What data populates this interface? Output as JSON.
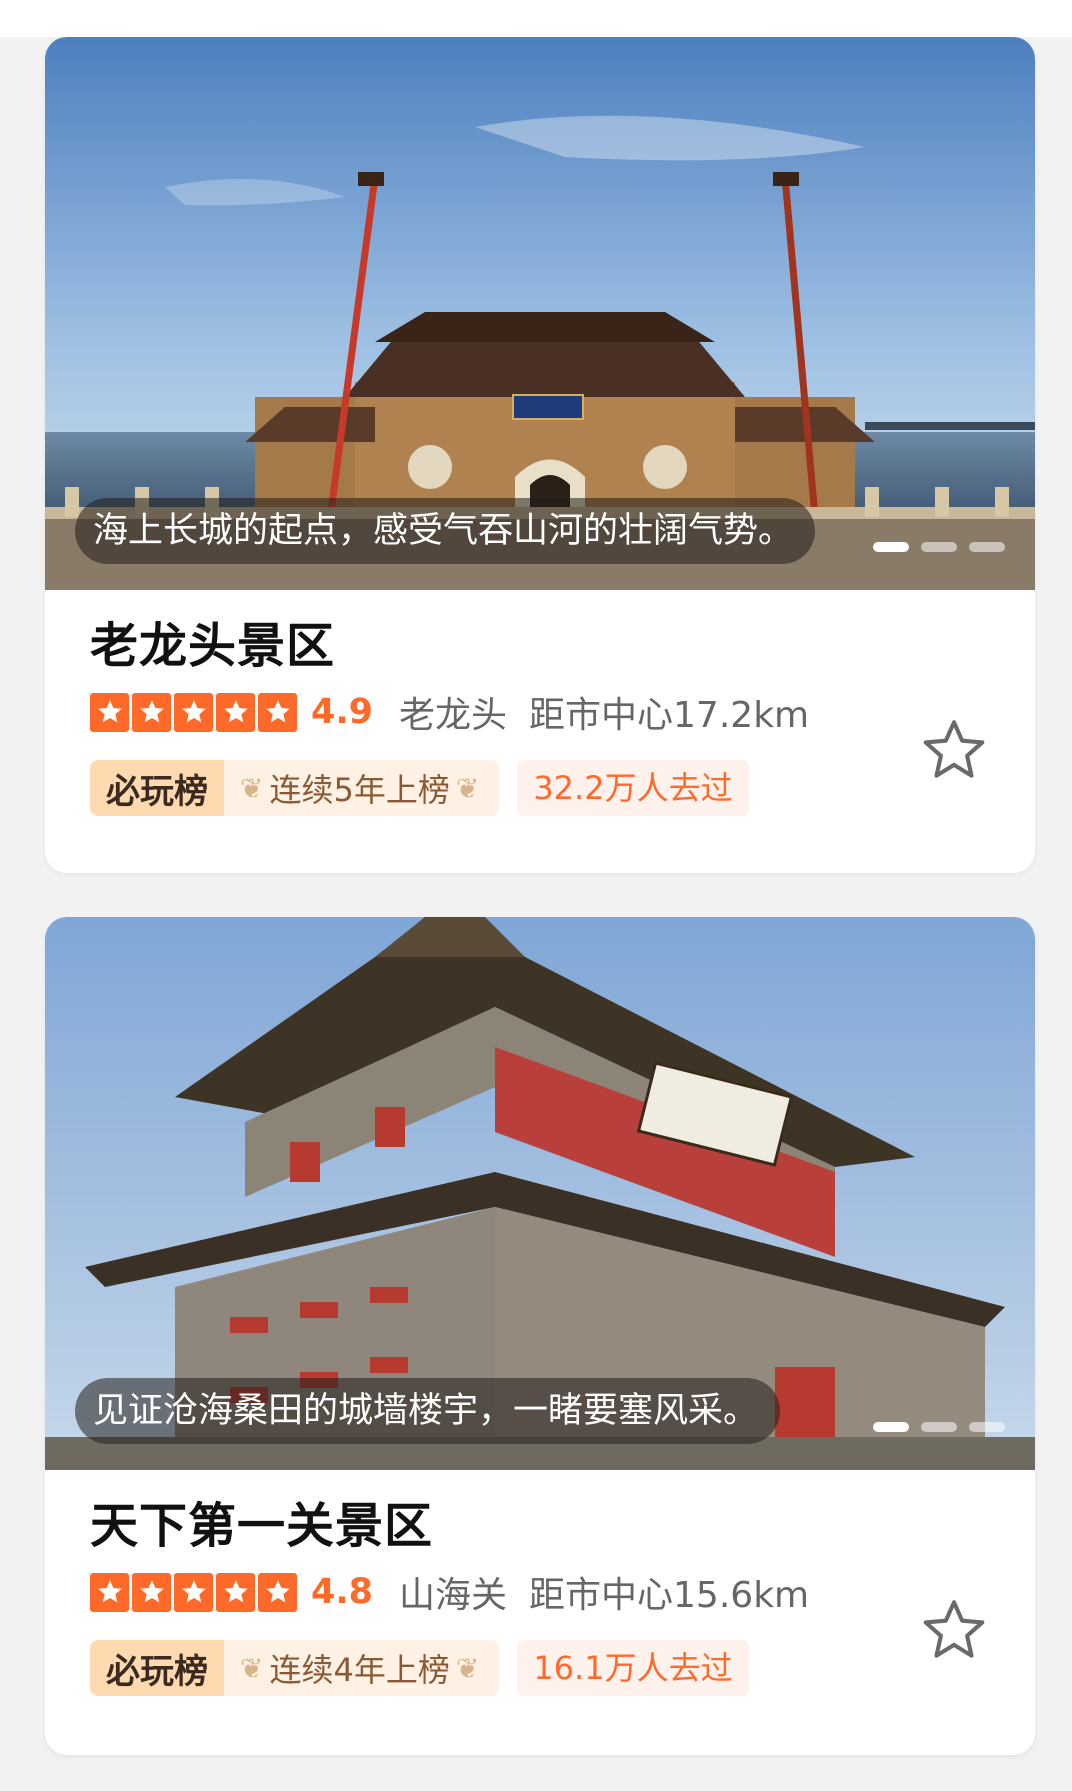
{
  "cards": [
    {
      "caption": "海上长城的起点，感受气吞山河的壮阔气势。",
      "title": "老龙头景区",
      "rating": "4.9",
      "stars": 5,
      "area": "老龙头",
      "distance": "距市中心17.2km",
      "rank_brand": "必玩榜",
      "rank_text": "连续5年上榜",
      "visits": "32.2万人去过",
      "carousel_index": 1,
      "carousel_count": 3
    },
    {
      "caption": "见证沧海桑田的城墙楼宇，一睹要塞风采。",
      "title": "天下第一关景区",
      "rating": "4.8",
      "stars": 5,
      "area": "山海关",
      "distance": "距市中心15.6km",
      "rank_brand": "必玩榜",
      "rank_text": "连续4年上榜",
      "visits": "16.1万人去过",
      "carousel_index": 1,
      "carousel_count": 3
    }
  ],
  "icons": {
    "rating": "star-icon",
    "favorite": "star-outline-icon",
    "laurel": "laurel-icon"
  },
  "colors": {
    "accent": "#ff6a2a",
    "rank_bg": "#fff1e3",
    "visit_bg": "#fff1ec"
  }
}
